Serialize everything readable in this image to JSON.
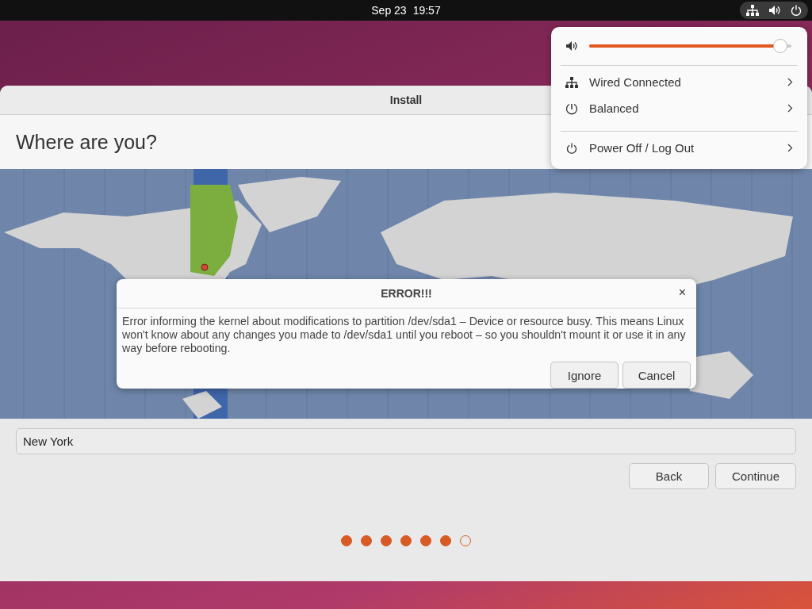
{
  "top_bar": {
    "date": "Sep 23",
    "time": "19:57"
  },
  "quick_settings": {
    "volume": {
      "level": 0.98
    },
    "groups": [
      {
        "items": [
          {
            "label": "Wired Connected"
          },
          {
            "label": "Balanced"
          }
        ]
      },
      {
        "items": [
          {
            "label": "Power Off / Log Out"
          }
        ]
      }
    ]
  },
  "window": {
    "title": "Install"
  },
  "page": {
    "heading": "Where are you?",
    "location_field": {
      "value": "New York"
    },
    "buttons": [
      "Back",
      "Continue"
    ],
    "steps": [
      {
        "completed": true
      },
      {
        "completed": true
      },
      {
        "completed": true
      },
      {
        "completed": true
      },
      {
        "completed": true
      },
      {
        "completed": true
      },
      {
        "completed": false
      }
    ]
  },
  "dialog": {
    "title": "ERROR!!!",
    "close": "×",
    "message": "Error informing the kernel about modifications to partition /dev/sda1 – Device or resource busy. This means Linux won't know about any changes you made to /dev/sda1 until you reboot – so you shouldn't mount it or use it in any way before rebooting.",
    "buttons": [
      "Ignore",
      "Cancel"
    ]
  }
}
